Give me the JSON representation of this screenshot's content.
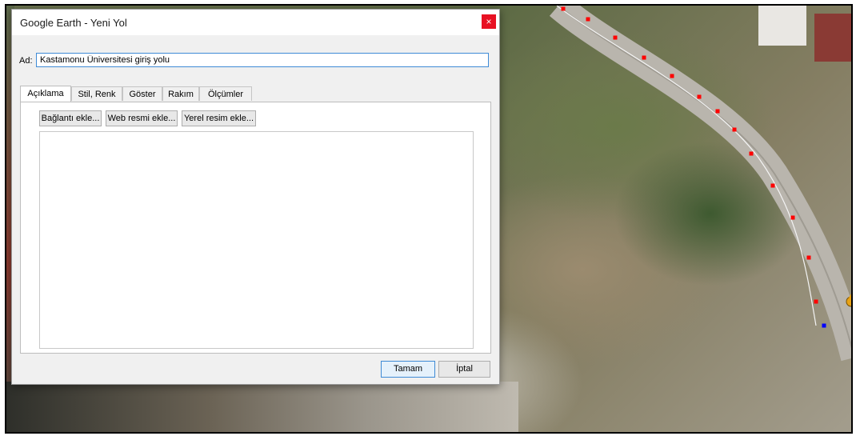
{
  "window": {
    "title": "Google Earth - Yeni Yol",
    "close_glyph": "×"
  },
  "form": {
    "name_label": "Ad:",
    "name_value": "Kastamonu Üniversitesi giriş yolu"
  },
  "tabs": [
    {
      "label": "Açıklama",
      "active": true
    },
    {
      "label": "Stil, Renk",
      "active": false
    },
    {
      "label": "Göster",
      "active": false
    },
    {
      "label": "Rakım",
      "active": false
    },
    {
      "label": "Ölçümler",
      "active": false
    }
  ],
  "description_tab": {
    "add_link": "Bağlantı ekle...",
    "add_web_image": "Web resmi ekle...",
    "add_local_image": "Yerel resim ekle...",
    "text": ""
  },
  "buttons": {
    "ok": "Tamam",
    "cancel": "İptal"
  },
  "map": {
    "path_color": "#ff0000",
    "end_point_color": "#0000ff",
    "pin_color": "#e8a317",
    "path_points_count": 18
  }
}
